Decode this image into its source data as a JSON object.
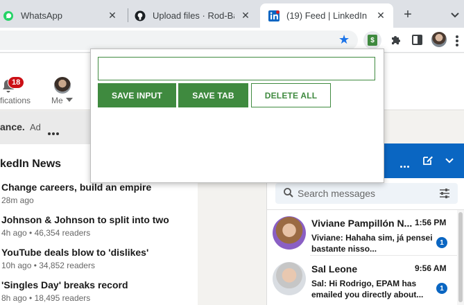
{
  "browser": {
    "tabs": [
      {
        "title": "WhatsApp",
        "icon": "whatsapp-icon"
      },
      {
        "title": "Upload files · Rod-Barl",
        "icon": "github-icon"
      },
      {
        "title": "(19) Feed | LinkedIn",
        "icon": "linkedin-icon",
        "active": true
      }
    ],
    "new_tab_label": "+"
  },
  "linkedin": {
    "header": {
      "notifications_badge": "18",
      "notifications_label": "fications",
      "me_label": "Me"
    },
    "ad": {
      "text": "ance.",
      "label": "Ad"
    },
    "news": {
      "title": "kedIn News",
      "items": [
        {
          "headline": "Change careers, build an empire",
          "meta": "28m ago"
        },
        {
          "headline": "Johnson & Johnson to split into two",
          "meta": "4h ago • 46,354 readers"
        },
        {
          "headline": "YouTube deals blow to 'dislikes'",
          "meta": "10h ago • 34,852 readers"
        },
        {
          "headline": "'Singles Day' breaks record",
          "meta": "8h ago • 18,495 readers"
        }
      ]
    },
    "messaging": {
      "search_placeholder": "Search messages",
      "conversations": [
        {
          "name": "Viviane Pampillón N...",
          "time": "1:56 PM",
          "preview": "Viviane: Hahaha sim, já pensei bastante nisso...",
          "unread": "1"
        },
        {
          "name": "Sal Leone",
          "time": "9:56 AM",
          "preview": "Sal: Hi Rodrigo, EPAM has emailed you directly about...",
          "unread": "1"
        }
      ]
    }
  },
  "extension_popup": {
    "input_value": "",
    "save_input_label": "SAVE INPUT",
    "save_tab_label": "SAVE TAB",
    "delete_all_label": "DELETE ALL",
    "accent_color": "#3f8a3f"
  },
  "colors": {
    "linkedin_blue": "#0a66c2",
    "badge_red": "#cc1016",
    "star_blue": "#1a73e8"
  }
}
